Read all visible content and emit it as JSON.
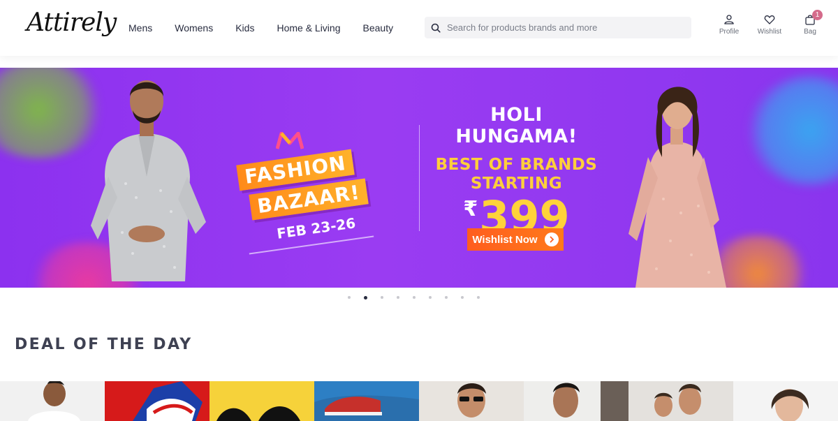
{
  "brand": {
    "name": "Attirely"
  },
  "nav": {
    "items": [
      {
        "label": "Mens"
      },
      {
        "label": "Womens"
      },
      {
        "label": "Kids"
      },
      {
        "label": "Home & Living"
      },
      {
        "label": "Beauty"
      }
    ]
  },
  "search": {
    "placeholder": "Search for products brands and more"
  },
  "actions": {
    "profile_label": "Profile",
    "wishlist_label": "Wishlist",
    "bag_label": "Bag",
    "bag_count": "1"
  },
  "banner": {
    "fashion_line1": "FASHION",
    "fashion_line2": "BAZAAR!",
    "dates": "FEB 23-26",
    "title": "HOLI HUNGAMA!",
    "subtitle_line1": "BEST OF BRANDS",
    "subtitle_line2": "STARTING",
    "price_currency": "₹",
    "price": "399",
    "cta": "Wishlist Now"
  },
  "carousel": {
    "slide_count": 9,
    "active_index": 1
  },
  "section": {
    "title": "DEAL OF THE DAY"
  },
  "colors": {
    "banner_purple": "#8c31ef",
    "promo_yellow": "#ffcf3b",
    "cta_orange": "#ff5d1f",
    "bag_badge": "#d46b8b"
  }
}
